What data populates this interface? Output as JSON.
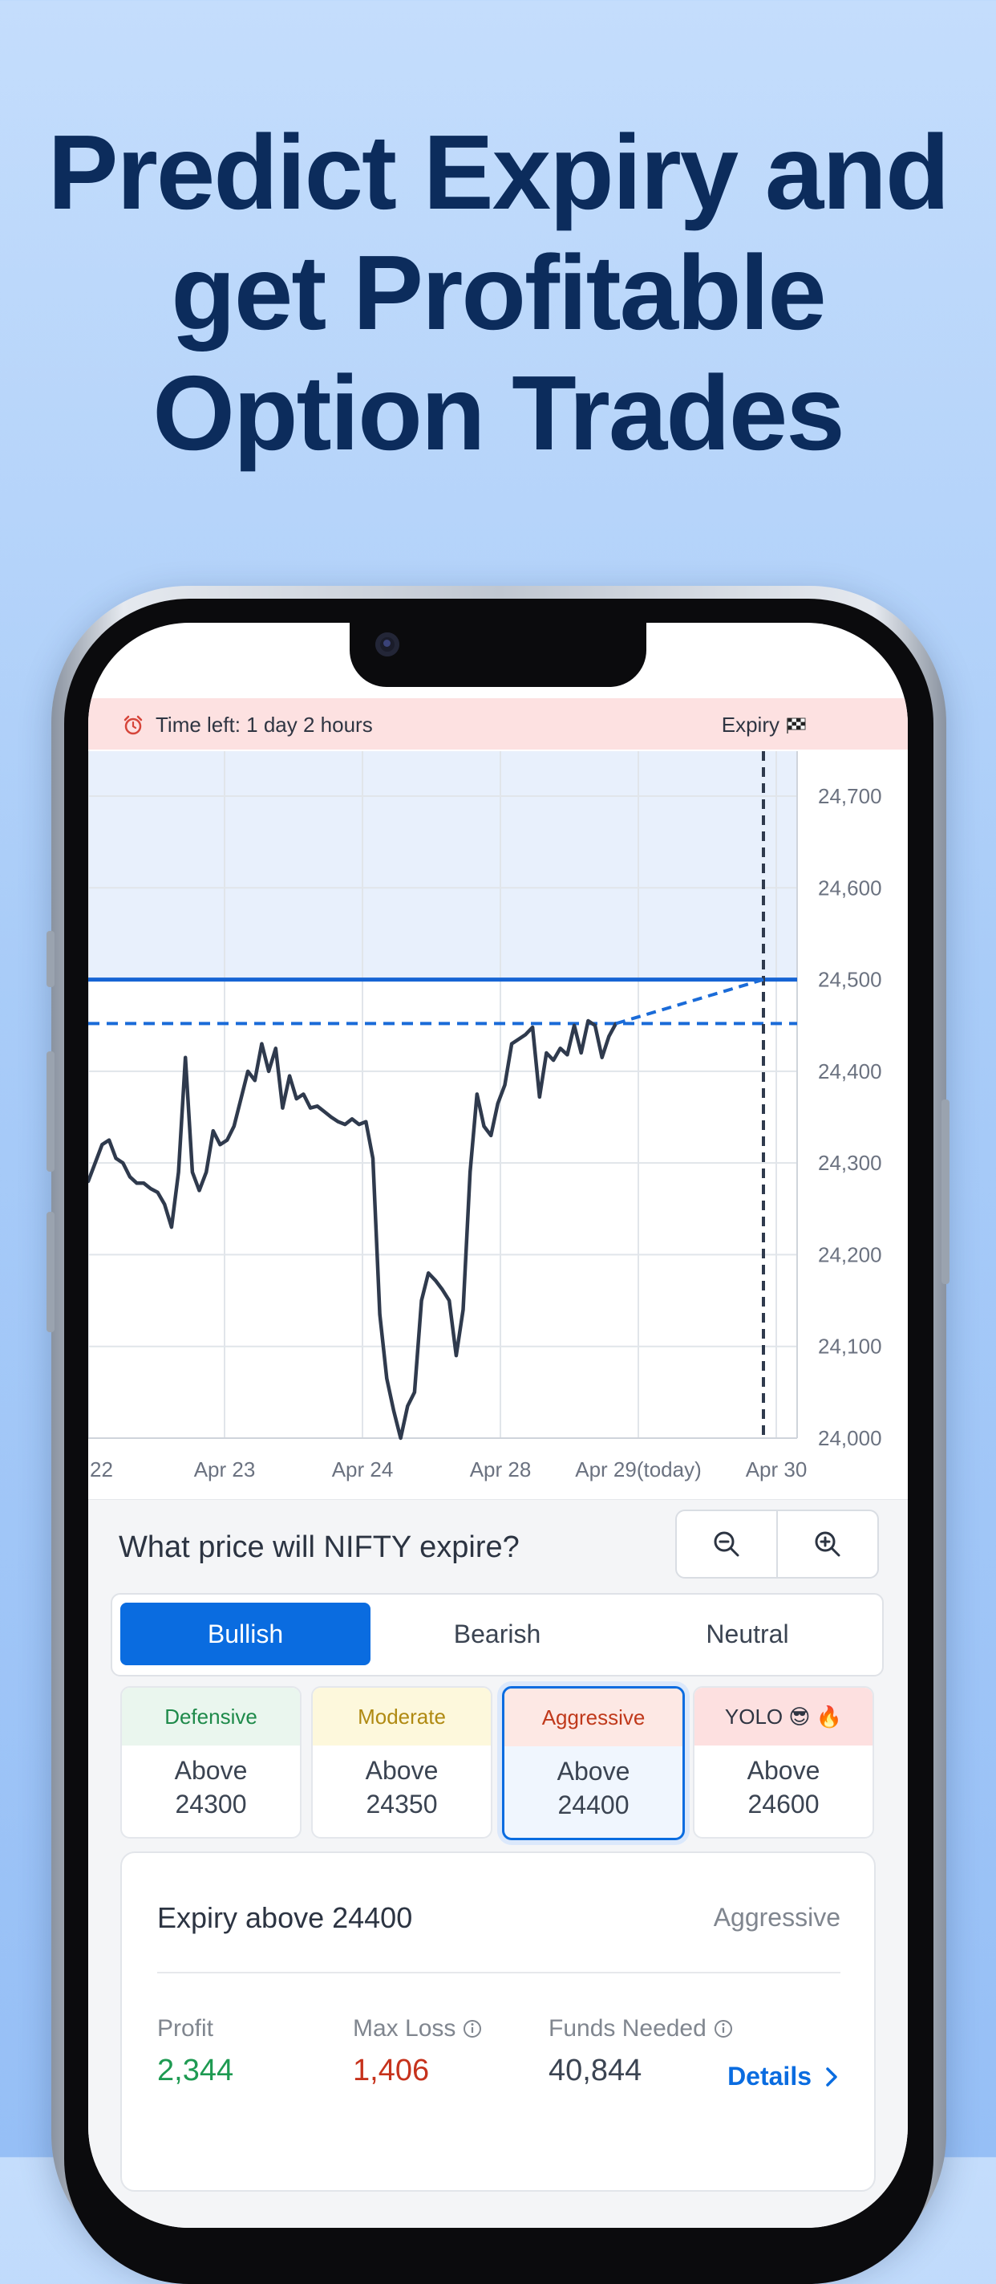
{
  "headline": {
    "lines": [
      "Predict Expiry and",
      "get Profitable",
      "Option Trades"
    ]
  },
  "banner": {
    "time_left": "Time left: 1 day 2 hours",
    "expiry_label": "Expiry",
    "alarm_icon": "alarm-clock-icon",
    "flag_icon": "checkered-flag-icon",
    "background": "#fde1e1"
  },
  "chart_data": {
    "type": "line",
    "x_ticks": [
      "22",
      "Apr 23",
      "Apr 24",
      "Apr 28",
      "Apr 29(today)",
      "Apr 30"
    ],
    "y_ticks": [
      "24,700",
      "24,600",
      "24,500",
      "24,400",
      "24,300",
      "24,200",
      "24,100",
      "24,000"
    ],
    "ylim": [
      24000,
      24750
    ],
    "series": [
      {
        "color": "#2f3a4d",
        "values": [
          24280,
          24300,
          24320,
          24325,
          24305,
          24300,
          24285,
          24278,
          24278,
          24272,
          24268,
          24255,
          24230,
          24290,
          24415,
          24290,
          24270,
          24290,
          24335,
          24320,
          24325,
          24340,
          24370,
          24400,
          24390,
          24430,
          24400,
          24425,
          24360,
          24395,
          24370,
          24375,
          24360,
          24362,
          24356,
          24350,
          24345,
          24342,
          24348,
          24342,
          24345,
          24305,
          24135,
          24065,
          24030,
          24000,
          24035,
          24050,
          24150,
          24180,
          24172,
          24162,
          24150,
          24090,
          24140,
          24290,
          24375,
          24340,
          24330,
          24365,
          24385,
          24430,
          24435,
          24440,
          24448,
          24372,
          24420,
          24412,
          24425,
          24418,
          24450,
          24420,
          24455,
          24450,
          24415,
          24438,
          24452
        ]
      }
    ],
    "selected_level": 24500,
    "current_level": 24452,
    "projection": [
      [
        24452,
        24500
      ]
    ],
    "colors": {
      "target_line": "#1664d4",
      "projection": "#1a6bd8",
      "expiry_marker": "#2f3a4d",
      "shaded_zone": "#dbe8fb"
    }
  },
  "panel": {
    "question": "What price will NIFTY expire?",
    "zoom_out_icon": "zoom-out-icon",
    "zoom_in_icon": "zoom-in-icon",
    "segments": [
      {
        "label": "Bullish",
        "active": true
      },
      {
        "label": "Bearish",
        "active": false
      },
      {
        "label": "Neutral",
        "active": false
      }
    ],
    "strategies": [
      {
        "name": "Defensive",
        "line1": "Above",
        "line2": "24300",
        "head_bg": "#eaf6ee",
        "head_color": "#1e8a4a"
      },
      {
        "name": "Moderate",
        "line1": "Above",
        "line2": "24350",
        "head_bg": "#fdf8dc",
        "head_color": "#b08a12"
      },
      {
        "name": "Aggressive",
        "line1": "Above",
        "line2": "24400",
        "head_bg": "#fde8e4",
        "head_color": "#c0391b",
        "selected": true
      },
      {
        "name": "YOLO 😎 🔥",
        "line1": "Above",
        "line2": "24600",
        "head_bg": "#fde0e0",
        "head_color": "#2f3542"
      }
    ],
    "summary": {
      "title": "Expiry above 24400",
      "tag": "Aggressive",
      "profit_label": "Profit",
      "profit_value": "2,344",
      "max_loss_label": "Max Loss",
      "max_loss_value": "1,406",
      "funds_label": "Funds Needed",
      "funds_value": "40,844",
      "details_label": "Details",
      "colors": {
        "profit": "#1e9a52",
        "loss": "#c6321c",
        "link": "#0a6ce0"
      }
    }
  }
}
